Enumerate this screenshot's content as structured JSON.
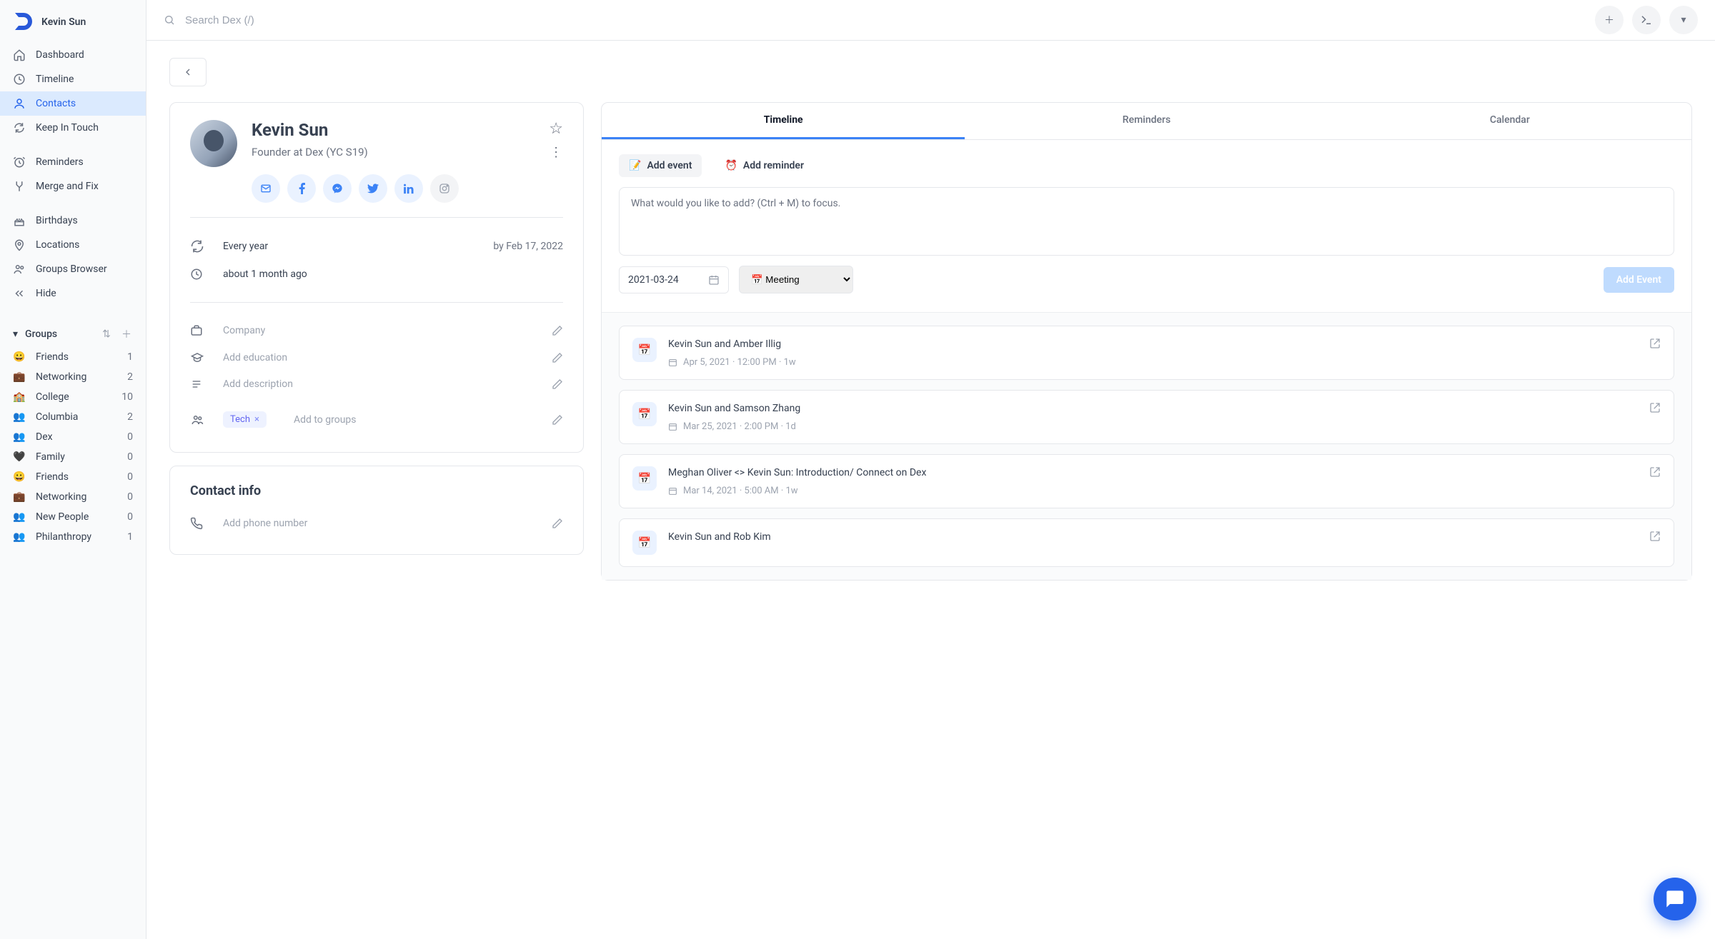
{
  "app": {
    "user_display_name": "Kevin Sun",
    "search_placeholder": "Search Dex (/)"
  },
  "sidebar": {
    "items": [
      {
        "icon": "home",
        "label": "Dashboard"
      },
      {
        "icon": "clock",
        "label": "Timeline"
      },
      {
        "icon": "user",
        "label": "Contacts",
        "active": true
      },
      {
        "icon": "refresh",
        "label": "Keep In Touch"
      },
      {
        "icon": "alarm",
        "label": "Reminders"
      },
      {
        "icon": "merge",
        "label": "Merge and Fix"
      },
      {
        "icon": "cake",
        "label": "Birthdays"
      },
      {
        "icon": "pin",
        "label": "Locations"
      },
      {
        "icon": "people",
        "label": "Groups Browser"
      },
      {
        "icon": "chevrons",
        "label": "Hide"
      }
    ],
    "groups_label": "Groups",
    "groups": [
      {
        "emoji": "😀",
        "label": "Friends",
        "count": "1"
      },
      {
        "emoji": "💼",
        "label": "Networking",
        "count": "2"
      },
      {
        "emoji": "🏫",
        "label": "College",
        "count": "10"
      },
      {
        "emoji": "👥",
        "label": "Columbia",
        "count": "2"
      },
      {
        "emoji": "👥",
        "label": "Dex",
        "count": "0"
      },
      {
        "emoji": "🖤",
        "label": "Family",
        "count": "0"
      },
      {
        "emoji": "😀",
        "label": "Friends",
        "count": "0"
      },
      {
        "emoji": "💼",
        "label": "Networking",
        "count": "0"
      },
      {
        "emoji": "👥",
        "label": "New People",
        "count": "0"
      },
      {
        "emoji": "👥",
        "label": "Philanthropy",
        "count": "1"
      }
    ]
  },
  "contact": {
    "name": "Kevin Sun",
    "subtitle": "Founder at Dex (YC S19)",
    "recurrence": "Every year",
    "recurrence_by": "by Feb 17, 2022",
    "last_touch": "about 1 month ago",
    "company_placeholder": "Company",
    "education_placeholder": "Add education",
    "description_placeholder": "Add description",
    "tag": "Tech",
    "add_to_groups_placeholder": "Add to groups",
    "contact_info_heading": "Contact info",
    "phone_placeholder": "Add phone number"
  },
  "right": {
    "tabs": {
      "timeline": "Timeline",
      "reminders": "Reminders",
      "calendar": "Calendar"
    },
    "add_event_btn": "Add event",
    "add_reminder_btn": "Add reminder",
    "compose_placeholder": "What would you like to add? (Ctrl + M) to focus.",
    "date_value": "2021-03-24",
    "type_value": "📅 Meeting",
    "submit_label": "Add Event",
    "events": [
      {
        "title": "Kevin Sun and Amber Illig",
        "meta": "Apr 5, 2021 · 12:00 PM · 1w"
      },
      {
        "title": "Kevin Sun and Samson Zhang",
        "meta": "Mar 25, 2021 · 2:00 PM · 1d"
      },
      {
        "title": "Meghan Oliver <> Kevin Sun: Introduction/ Connect on Dex",
        "meta": "Mar 14, 2021 · 5:00 AM · 1w"
      },
      {
        "title": "Kevin Sun and Rob Kim",
        "meta": ""
      }
    ]
  }
}
